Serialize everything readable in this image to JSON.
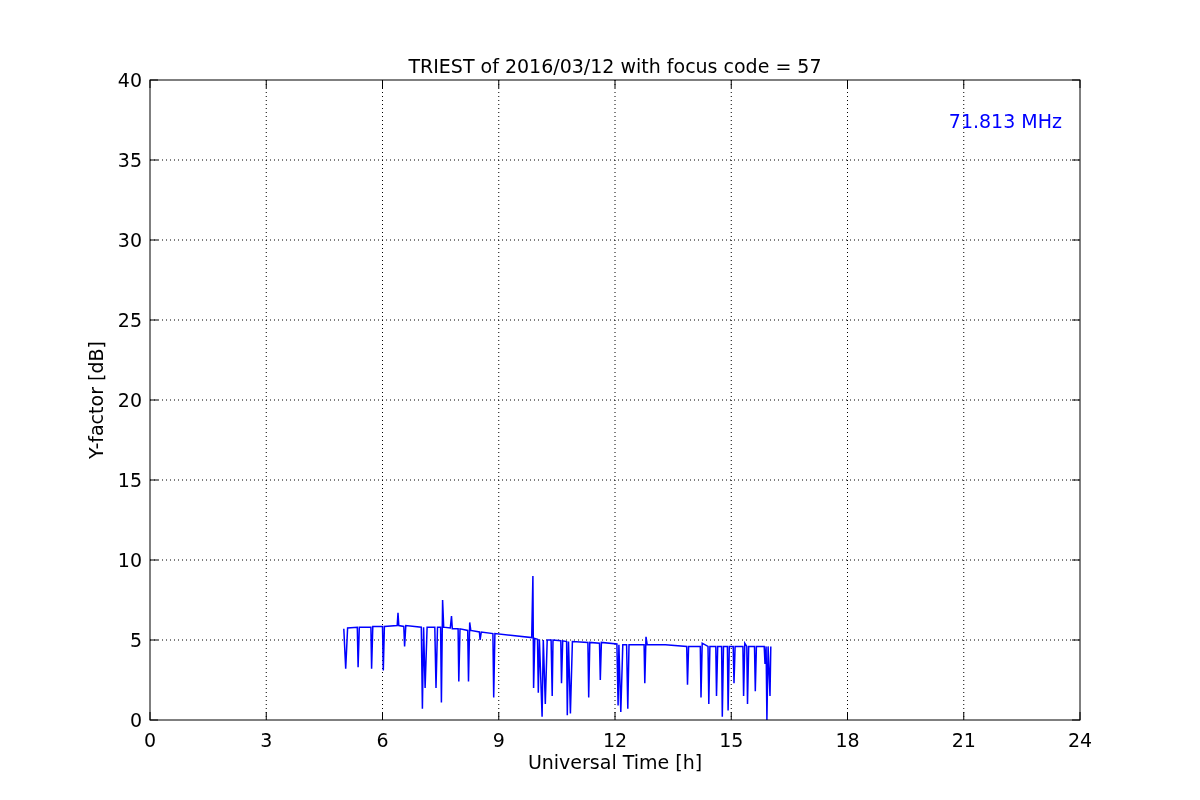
{
  "chart_data": {
    "type": "line",
    "title": "TRIEST of 2016/03/12 with focus code = 57",
    "xlabel": "Universal Time [h]",
    "ylabel": "Y-factor [dB]",
    "x": [
      5.0,
      5.05,
      5.1,
      5.35,
      5.37,
      5.4,
      5.7,
      5.72,
      5.75,
      6.0,
      6.02,
      6.05,
      6.38,
      6.4,
      6.42,
      6.55,
      6.57,
      6.6,
      7.0,
      7.03,
      7.06,
      7.1,
      7.15,
      7.35,
      7.38,
      7.42,
      7.5,
      7.52,
      7.55,
      7.58,
      7.75,
      7.78,
      7.8,
      7.95,
      7.97,
      8.0,
      8.2,
      8.22,
      8.25,
      8.28,
      8.5,
      8.52,
      8.55,
      8.85,
      8.87,
      8.9,
      9.3,
      9.85,
      9.88,
      9.9,
      9.93,
      10.0,
      10.02,
      10.05,
      10.12,
      10.15,
      10.2,
      10.25,
      10.35,
      10.38,
      10.4,
      10.6,
      10.62,
      10.65,
      10.75,
      10.77,
      10.8,
      10.85,
      10.9,
      11.3,
      11.32,
      11.35,
      11.6,
      11.62,
      11.65,
      12.05,
      12.08,
      12.1,
      12.15,
      12.2,
      12.3,
      12.33,
      12.36,
      12.75,
      12.77,
      12.8,
      12.83,
      13.3,
      13.85,
      13.87,
      13.9,
      14.2,
      14.22,
      14.25,
      14.4,
      14.42,
      14.45,
      14.6,
      14.62,
      14.65,
      14.75,
      14.77,
      14.8,
      14.9,
      14.92,
      14.95,
      15.05,
      15.07,
      15.1,
      15.3,
      15.32,
      15.35,
      15.4,
      15.42,
      15.45,
      15.6,
      15.62,
      15.65,
      15.85,
      15.87,
      15.9,
      15.92,
      15.95,
      16.0,
      16.02
    ],
    "series": [
      {
        "name": "71.813 MHz",
        "color": "#0000ff",
        "values": [
          5.7,
          3.2,
          5.75,
          5.8,
          3.3,
          5.8,
          5.8,
          3.2,
          5.85,
          5.85,
          3.1,
          5.85,
          5.9,
          6.7,
          5.9,
          5.85,
          4.6,
          5.9,
          5.8,
          0.7,
          5.8,
          2.0,
          5.8,
          5.8,
          2.0,
          5.8,
          5.8,
          1.1,
          7.5,
          5.8,
          5.75,
          6.5,
          5.7,
          5.7,
          2.4,
          5.7,
          5.6,
          2.4,
          6.1,
          5.6,
          5.5,
          5.0,
          5.5,
          5.4,
          1.4,
          5.4,
          5.3,
          5.15,
          9.0,
          2.0,
          5.1,
          5.05,
          1.7,
          5.05,
          0.2,
          5.0,
          1.0,
          5.0,
          5.0,
          1.5,
          5.0,
          4.95,
          2.3,
          4.95,
          4.9,
          0.3,
          4.9,
          0.4,
          4.9,
          4.85,
          1.4,
          4.85,
          4.8,
          2.5,
          4.85,
          4.75,
          0.9,
          4.7,
          0.5,
          4.7,
          4.7,
          0.7,
          4.7,
          4.7,
          2.3,
          5.2,
          4.7,
          4.7,
          4.6,
          2.2,
          4.6,
          4.6,
          1.4,
          4.8,
          4.6,
          1.0,
          4.6,
          4.6,
          1.5,
          4.6,
          4.6,
          0.2,
          4.6,
          4.6,
          0.6,
          4.6,
          4.6,
          2.3,
          4.6,
          4.6,
          1.5,
          4.8,
          4.6,
          1.0,
          4.6,
          4.6,
          1.8,
          4.6,
          4.6,
          3.5,
          4.6,
          0.0,
          4.6,
          1.5,
          4.6
        ]
      }
    ],
    "xlim": [
      0,
      24
    ],
    "ylim": [
      0,
      40
    ],
    "xticks": [
      0,
      3,
      6,
      9,
      12,
      15,
      18,
      21,
      24
    ],
    "yticks": [
      0,
      5,
      10,
      15,
      20,
      25,
      30,
      35,
      40
    ],
    "grid": true
  }
}
